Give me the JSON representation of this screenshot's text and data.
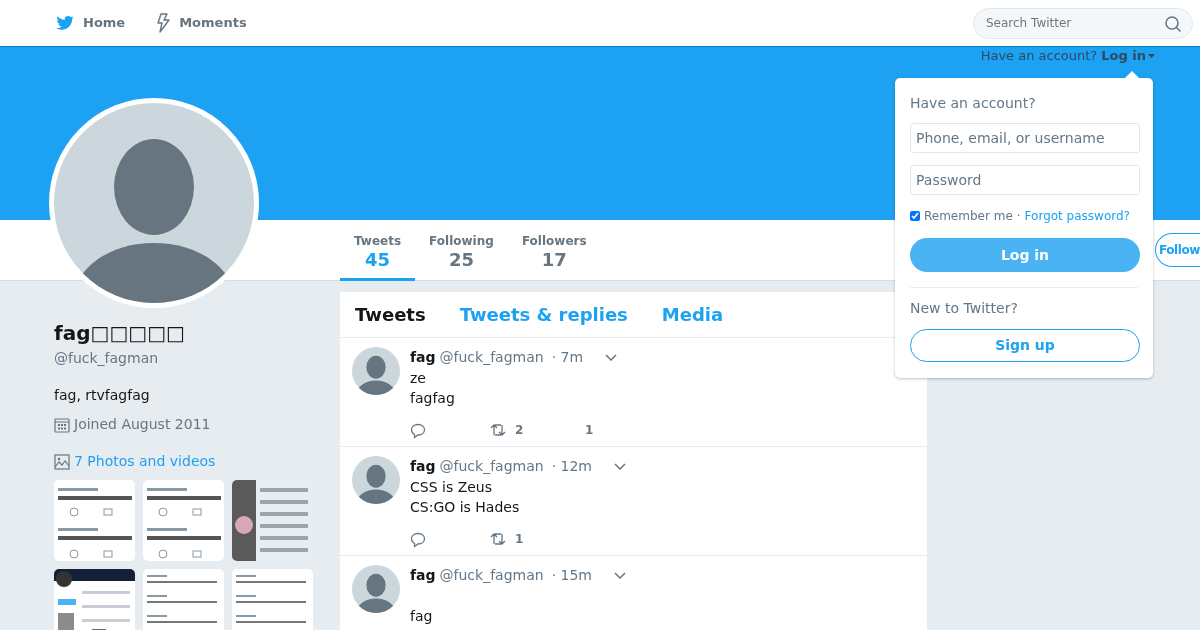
{
  "nav": {
    "items": [
      {
        "label": "Home",
        "kind": "bird"
      },
      {
        "label": "Moments",
        "kind": "bolt"
      }
    ]
  },
  "search": {
    "placeholder": "Search Twitter"
  },
  "login_prompt": {
    "text": "Have an account?",
    "link": "Log in"
  },
  "profile": {
    "name": "fag□□□□□",
    "handle": "@fuck_fagman",
    "bio": "fag, rtvfagfag",
    "joined": "Joined August 2011",
    "media_link": "7 Photos and videos"
  },
  "stats": [
    {
      "label": "Tweets",
      "value": "45",
      "selected": true
    },
    {
      "label": "Following",
      "value": "25",
      "selected": false
    },
    {
      "label": "Followers",
      "value": "17",
      "selected": false
    }
  ],
  "follow_button": "Follow",
  "timeline_tabs": [
    {
      "label": "Tweets",
      "selected": true
    },
    {
      "label": "Tweets & replies",
      "selected": false
    },
    {
      "label": "Media",
      "selected": false
    }
  ],
  "tweets": [
    {
      "name": "fag",
      "handle": "@fuck_fagman",
      "time": "· 7m",
      "lines": [
        "ze",
        "fagfag"
      ],
      "retweets": "2",
      "likes": "1"
    },
    {
      "name": "fag",
      "handle": "@fuck_fagman",
      "time": "· 12m",
      "lines": [
        "CSS is Zeus",
        "CS:GO is Hades"
      ],
      "retweets": "1"
    },
    {
      "name": "fag",
      "handle": "@fuck_fagman",
      "time": "· 15m",
      "lines": [
        "fag"
      ]
    }
  ],
  "login_dropdown": {
    "title": "Have an account?",
    "username_placeholder": "Phone, email, or username",
    "password_placeholder": "Password",
    "remember": {
      "label": "Remember me",
      "checked": true
    },
    "separator": "·",
    "forgot": "Forgot password?",
    "login_button": "Log in",
    "signup_title": "New to Twitter?",
    "signup_button": "Sign up"
  }
}
